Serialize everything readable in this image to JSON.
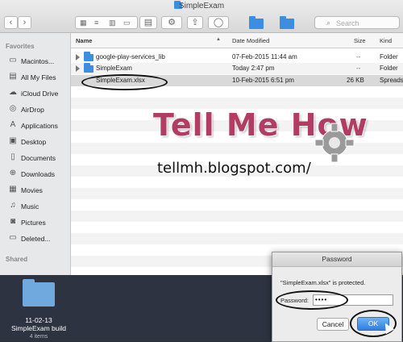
{
  "window": {
    "title": "SimpleExam"
  },
  "toolbar": {
    "back": "‹",
    "forward": "›",
    "search_placeholder": "Search"
  },
  "sidebar": {
    "favorites_label": "Favorites",
    "shared_label": "Shared",
    "items": [
      {
        "label": "Macintos...",
        "icon": "disk-icon"
      },
      {
        "label": "All My Files",
        "icon": "files-icon"
      },
      {
        "label": "iCloud Drive",
        "icon": "cloud-icon"
      },
      {
        "label": "AirDrop",
        "icon": "airdrop-icon"
      },
      {
        "label": "Applications",
        "icon": "apps-icon"
      },
      {
        "label": "Desktop",
        "icon": "desktop-icon"
      },
      {
        "label": "Documents",
        "icon": "documents-icon"
      },
      {
        "label": "Downloads",
        "icon": "downloads-icon"
      },
      {
        "label": "Movies",
        "icon": "movies-icon"
      },
      {
        "label": "Music",
        "icon": "music-icon"
      },
      {
        "label": "Pictures",
        "icon": "pictures-icon"
      },
      {
        "label": "Deleted...",
        "icon": "folder-icon"
      }
    ]
  },
  "list": {
    "columns": {
      "name": "Name",
      "date": "Date Modified",
      "size": "Size",
      "kind": "Kind"
    },
    "rows": [
      {
        "name": "google-play-services_lib",
        "date": "07-Feb-2015 11:44 am",
        "size": "--",
        "kind": "Folder"
      },
      {
        "name": "SimpleExam",
        "date": "Today 2:47 pm",
        "size": "--",
        "kind": "Folder"
      },
      {
        "name": "SimpleExam.xlsx",
        "date": "10-Feb-2015 6:51 pm",
        "size": "26 KB",
        "kind": "Spreads"
      }
    ]
  },
  "watermark": {
    "title": "Tell Me How",
    "url": "tellmh.blogspot.com/"
  },
  "desktop_item": {
    "line1": "11-02-13",
    "line2": "SimpleExam build",
    "line3": "4 items"
  },
  "dialog": {
    "title": "Password",
    "message": "\"SimpleExam.xlsx\" is protected.",
    "password_label": "Password:",
    "password_value": "••••",
    "cancel_label": "Cancel",
    "ok_label": "OK"
  },
  "colors": {
    "accent": "#2f7fe0",
    "folder": "#3d8de0",
    "watermark": "#b13d63"
  }
}
